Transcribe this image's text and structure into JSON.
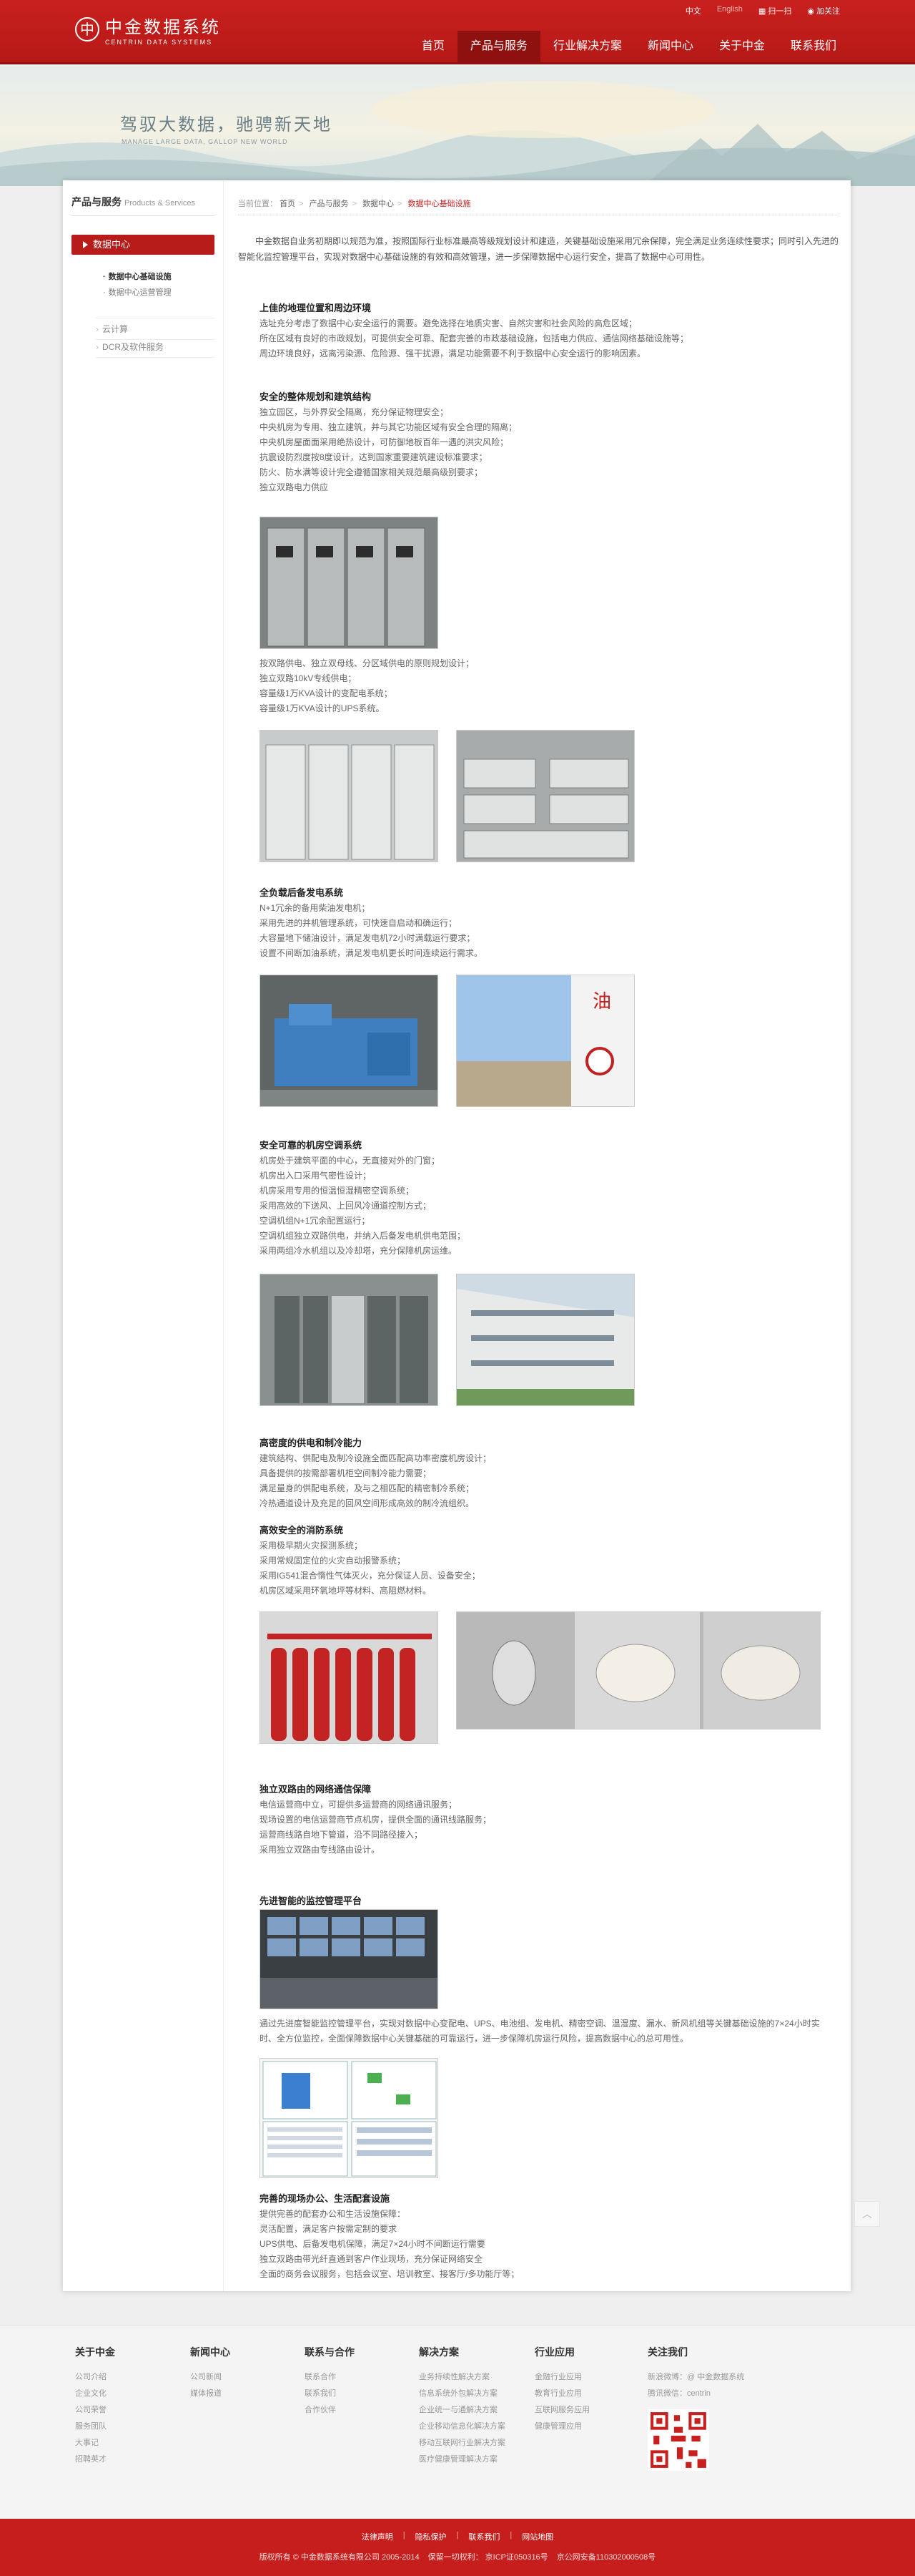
{
  "header": {
    "logo_mark": "中",
    "logo_cn": "中金数据系统",
    "logo_en": "CENTRIN DATA SYSTEMS",
    "lang_cn": "中文",
    "lang_en": "English",
    "qr_link": "扫一扫",
    "follow_link": "加关注",
    "nav": [
      "首页",
      "产品与服务",
      "行业解决方案",
      "新闻中心",
      "关于中金",
      "联系我们"
    ]
  },
  "banner": {
    "slogan": "驾驭大数据，驰骋新天地",
    "slogan_en": "MANAGE LARGE DATA, GALLOP NEW WORLD"
  },
  "sidebar": {
    "title": "产品与服务",
    "title_en": "Products & Services",
    "active": "数据中心",
    "subs": [
      "数据中心基础设施",
      "数据中心运营管理"
    ],
    "links": [
      "云计算",
      "DCR及软件服务"
    ]
  },
  "breadcrumb": {
    "prefix": "当前位置：",
    "items": [
      "首页",
      "产品与服务",
      "数据中心"
    ],
    "current": "数据中心基础设施"
  },
  "intro": "中金数据自业务初期即以规范为准，按照国际行业标准最高等级规划设计和建造，关键基础设施采用冗余保障，完全满足业务连续性要求；同时引入先进的智能化监控管理平台，实现对数据中心基础设施的有效和高效管理，进一步保障数据中心运行安全，提高了数据中心可用性。",
  "sections": [
    {
      "title": "上佳的地理位置和周边环境",
      "lines": [
        "选址充分考虑了数据中心安全运行的需要。避免选择在地质灾害、自然灾害和社会风险的高危区域；",
        "所在区域有良好的市政规划，可提供安全可靠、配套完善的市政基础设施，包括电力供应、通信网络基础设施等；",
        "周边环境良好，远离污染源、危险源、强干扰源，满足功能需要不利于数据中心安全运行的影响因素。"
      ]
    },
    {
      "title": "安全的整体规划和建筑结构",
      "lines": [
        "独立园区，与外界安全隔离，充分保证物理安全；",
        "中央机房为专用、独立建筑，并与其它功能区域有安全合理的隔离；",
        "中央机房屋面面采用绝热设计，可防御地板百年一遇的洪灾风险；",
        "抗震设防烈度按8度设计，达到国家重要建筑建设标准要求；",
        "防火、防水满等设计完全遵循国家相关规范最高级别要求；",
        "独立双路电力供应"
      ]
    },
    {
      "title": "",
      "lines": [
        "按双路供电、独立双母线、分区域供电的原则规划设计；",
        "独立双路10kV专线供电；",
        "容量级1万KVA设计的变配电系统；",
        "容量级1万KVA设计的UPS系统。"
      ]
    },
    {
      "title": "全负载后备发电系统",
      "lines": [
        "N+1冗余的备用柴油发电机；",
        "采用先进的并机管理系统，可快速自启动和确运行；",
        "大容量地下储油设计，满足发电机72小时满载运行要求；",
        "设置不间断加油系统，满足发电机更长时间连续运行需求。"
      ]
    },
    {
      "title": "安全可靠的机房空调系统",
      "lines": [
        "机房处于建筑平面的中心，无直接对外的门窗；",
        "机房出入口采用气密性设计；",
        "机房采用专用的恒温恒湿精密空调系统；",
        "采用高效的下送风、上回风冷通道控制方式；",
        "空调机组N+1冗余配置运行；",
        "空调机组独立双路供电，并纳入后备发电机供电范围；",
        "采用两组冷水机组以及冷却塔，充分保障机房运维。"
      ]
    },
    {
      "title": "高密度的供电和制冷能力",
      "lines": [
        "建筑结构、供配电及制冷设施全面匹配高功率密度机房设计；",
        "具备提供的按需部署机柜空间制冷能力需要；",
        "满足量身的供配电系统，及与之相匹配的精密制冷系统；",
        "冷热通道设计及充足的回风空间形成高效的制冷流组织。"
      ]
    },
    {
      "title": "高效安全的消防系统",
      "lines": [
        "采用极早期火灾探测系统；",
        "采用常规固定位的火灾自动报警系统；",
        "采用IG541混合惰性气体灭火，充分保证人员、设备安全；",
        "机房区域采用环氧地坪等材料、高阻燃材料。"
      ]
    },
    {
      "title": "独立双路由的网络通信保障",
      "lines": [
        "电信运营商中立，可提供多运营商的网络通讯服务；",
        "现场设置的电信运营商节点机房，提供全面的通讯线路服务；",
        "运营商线路自地下管道，沿不同路径接入；",
        "采用独立双路由专线路由设计。"
      ]
    },
    {
      "title": "先进智能的监控管理平台",
      "lines": []
    },
    {
      "title": "",
      "lines": [
        "通过先进度智能监控管理平台，实现对数据中心变配电、UPS、电池组、发电机、精密空调、温湿度、漏水、新风机组等关键基础设施的7×24小时实时、全方位监控，全面保障数据中心关键基础的可靠运行，进一步保障机房运行风险，提高数据中心的总可用性。"
      ]
    },
    {
      "title": "完善的现场办公、生活配套设施",
      "lines": [
        "提供完善的配套办公和生活设施保障：",
        "灵活配置，满足客户按需定制的要求",
        "UPS供电、后备发电机保障，满足7×24小时不间断运行需要",
        "独立双路由带光纤直通到客户作业现场，充分保证网络安全",
        "全面的商务会议服务，包括会议室、培训教室、接客厅/多功能厅等；"
      ]
    }
  ],
  "footer": {
    "columns": [
      {
        "title": "关于中金",
        "items": [
          "公司介绍",
          "企业文化",
          "公司荣誉",
          "服务团队",
          "大事记",
          "招聘英才"
        ]
      },
      {
        "title": "新闻中心",
        "items": [
          "公司新闻",
          "媒体报道"
        ]
      },
      {
        "title": "联系与合作",
        "items": [
          "联系合作",
          "联系我们",
          "合作伙伴"
        ]
      },
      {
        "title": "解决方案",
        "items": [
          "业务持续性解决方案",
          "信息系统外包解决方案",
          "企业统一与通解决方案",
          "企业移动信息化解决方案",
          "移动互联网行业解决方案",
          "医疗健康管理解决方案"
        ]
      },
      {
        "title": "行业应用",
        "items": [
          "金融行业应用",
          "教育行业应用",
          "互联网服务应用",
          "健康管理应用"
        ]
      }
    ],
    "follow": {
      "title": "关注我们",
      "weibo": "新浪微博：@ 中金数据系统",
      "wechat": "腾讯微信：centrin"
    }
  },
  "bottom": {
    "links": [
      "法律声明",
      "隐私保护",
      "联系我们",
      "网站地图"
    ],
    "copyright": "版权所有 © 中金数据系统有限公司 2005-2014",
    "icp": "保留一切权利： 京ICP证050316号",
    "police": "京公网安备110302000508号"
  },
  "scroll_top": "︿"
}
